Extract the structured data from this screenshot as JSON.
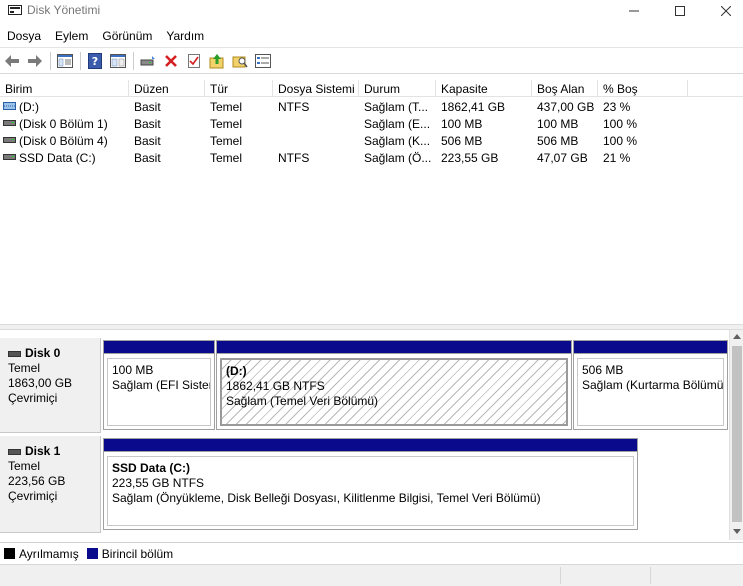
{
  "window": {
    "title": "Disk Yönetimi"
  },
  "menu": [
    "Dosya",
    "Eylem",
    "Görünüm",
    "Yardım"
  ],
  "toolbar": {
    "icons": [
      "back-arrow-icon",
      "forward-arrow-icon",
      "console-tree-icon",
      "help-icon",
      "properties-icon",
      "connect-drive-icon",
      "delete-icon",
      "check-icon",
      "up-folder-icon",
      "search-folder-icon",
      "list-view-icon"
    ]
  },
  "volume_list": {
    "columns": [
      "Birim",
      "Düzen",
      "Tür",
      "Dosya Sistemi",
      "Durum",
      "Kapasite",
      "Boş Alan",
      "% Boş"
    ],
    "rows": [
      {
        "birim": "(D:)",
        "duzen": "Basit",
        "tur": "Temel",
        "dosya_sistemi": "NTFS",
        "durum": "Sağlam (T...",
        "kapasite": "1862,41 GB",
        "bos_alan": "437,00 GB",
        "yuzde_bos": "23 %",
        "icon": "striped-volume-icon"
      },
      {
        "birim": "(Disk 0 Bölüm 1)",
        "duzen": "Basit",
        "tur": "Temel",
        "dosya_sistemi": "",
        "durum": "Sağlam (E...",
        "kapasite": "100 MB",
        "bos_alan": "100 MB",
        "yuzde_bos": "100 %",
        "icon": "volume-icon"
      },
      {
        "birim": "(Disk 0 Bölüm 4)",
        "duzen": "Basit",
        "tur": "Temel",
        "dosya_sistemi": "",
        "durum": "Sağlam (K...",
        "kapasite": "506 MB",
        "bos_alan": "506 MB",
        "yuzde_bos": "100 %",
        "icon": "volume-icon"
      },
      {
        "birim": "SSD Data (C:)",
        "duzen": "Basit",
        "tur": "Temel",
        "dosya_sistemi": "NTFS",
        "durum": "Sağlam (Ö...",
        "kapasite": "223,55 GB",
        "bos_alan": "47,07 GB",
        "yuzde_bos": "21 %",
        "icon": "volume-icon"
      }
    ]
  },
  "disks": [
    {
      "name": "Disk 0",
      "type": "Temel",
      "size": "1863,00 GB",
      "status": "Çevrimiçi",
      "partitions": [
        {
          "title": "",
          "line1": "100 MB",
          "line2": "Sağlam (EFI Sistem Bölümü)",
          "selected": false
        },
        {
          "title": "(D:)",
          "line1": "1862,41 GB NTFS",
          "line2": "Sağlam (Temel Veri Bölümü)",
          "selected": true
        },
        {
          "title": "",
          "line1": "506 MB",
          "line2": "Sağlam (Kurtarma Bölümü)",
          "selected": false
        }
      ]
    },
    {
      "name": "Disk 1",
      "type": "Temel",
      "size": "223,56 GB",
      "status": "Çevrimiçi",
      "partitions": [
        {
          "title": "SSD Data  (C:)",
          "line1": "223,55 GB NTFS",
          "line2": "Sağlam (Önyükleme, Disk Belleği Dosyası, Kilitlenme Bilgisi, Temel Veri Bölümü)",
          "selected": false
        }
      ]
    }
  ],
  "legend": [
    {
      "label": "Ayrılmamış",
      "color": "#000000"
    },
    {
      "label": "Birincil bölüm",
      "color": "#0a0a8c"
    }
  ],
  "colors": {
    "primary_partition": "#0a0a8c",
    "unallocated": "#000000"
  }
}
